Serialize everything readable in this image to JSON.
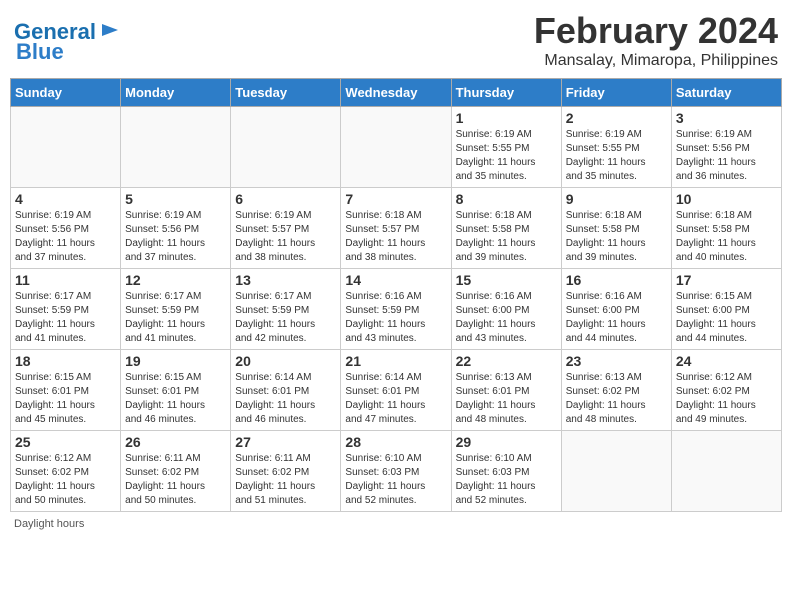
{
  "logo": {
    "line1": "General",
    "line2": "Blue"
  },
  "header": {
    "month": "February 2024",
    "location": "Mansalay, Mimaropa, Philippines"
  },
  "weekdays": [
    "Sunday",
    "Monday",
    "Tuesday",
    "Wednesday",
    "Thursday",
    "Friday",
    "Saturday"
  ],
  "weeks": [
    [
      {
        "day": "",
        "info": ""
      },
      {
        "day": "",
        "info": ""
      },
      {
        "day": "",
        "info": ""
      },
      {
        "day": "",
        "info": ""
      },
      {
        "day": "1",
        "info": "Sunrise: 6:19 AM\nSunset: 5:55 PM\nDaylight: 11 hours\nand 35 minutes."
      },
      {
        "day": "2",
        "info": "Sunrise: 6:19 AM\nSunset: 5:55 PM\nDaylight: 11 hours\nand 35 minutes."
      },
      {
        "day": "3",
        "info": "Sunrise: 6:19 AM\nSunset: 5:56 PM\nDaylight: 11 hours\nand 36 minutes."
      }
    ],
    [
      {
        "day": "4",
        "info": "Sunrise: 6:19 AM\nSunset: 5:56 PM\nDaylight: 11 hours\nand 37 minutes."
      },
      {
        "day": "5",
        "info": "Sunrise: 6:19 AM\nSunset: 5:56 PM\nDaylight: 11 hours\nand 37 minutes."
      },
      {
        "day": "6",
        "info": "Sunrise: 6:19 AM\nSunset: 5:57 PM\nDaylight: 11 hours\nand 38 minutes."
      },
      {
        "day": "7",
        "info": "Sunrise: 6:18 AM\nSunset: 5:57 PM\nDaylight: 11 hours\nand 38 minutes."
      },
      {
        "day": "8",
        "info": "Sunrise: 6:18 AM\nSunset: 5:58 PM\nDaylight: 11 hours\nand 39 minutes."
      },
      {
        "day": "9",
        "info": "Sunrise: 6:18 AM\nSunset: 5:58 PM\nDaylight: 11 hours\nand 39 minutes."
      },
      {
        "day": "10",
        "info": "Sunrise: 6:18 AM\nSunset: 5:58 PM\nDaylight: 11 hours\nand 40 minutes."
      }
    ],
    [
      {
        "day": "11",
        "info": "Sunrise: 6:17 AM\nSunset: 5:59 PM\nDaylight: 11 hours\nand 41 minutes."
      },
      {
        "day": "12",
        "info": "Sunrise: 6:17 AM\nSunset: 5:59 PM\nDaylight: 11 hours\nand 41 minutes."
      },
      {
        "day": "13",
        "info": "Sunrise: 6:17 AM\nSunset: 5:59 PM\nDaylight: 11 hours\nand 42 minutes."
      },
      {
        "day": "14",
        "info": "Sunrise: 6:16 AM\nSunset: 5:59 PM\nDaylight: 11 hours\nand 43 minutes."
      },
      {
        "day": "15",
        "info": "Sunrise: 6:16 AM\nSunset: 6:00 PM\nDaylight: 11 hours\nand 43 minutes."
      },
      {
        "day": "16",
        "info": "Sunrise: 6:16 AM\nSunset: 6:00 PM\nDaylight: 11 hours\nand 44 minutes."
      },
      {
        "day": "17",
        "info": "Sunrise: 6:15 AM\nSunset: 6:00 PM\nDaylight: 11 hours\nand 44 minutes."
      }
    ],
    [
      {
        "day": "18",
        "info": "Sunrise: 6:15 AM\nSunset: 6:01 PM\nDaylight: 11 hours\nand 45 minutes."
      },
      {
        "day": "19",
        "info": "Sunrise: 6:15 AM\nSunset: 6:01 PM\nDaylight: 11 hours\nand 46 minutes."
      },
      {
        "day": "20",
        "info": "Sunrise: 6:14 AM\nSunset: 6:01 PM\nDaylight: 11 hours\nand 46 minutes."
      },
      {
        "day": "21",
        "info": "Sunrise: 6:14 AM\nSunset: 6:01 PM\nDaylight: 11 hours\nand 47 minutes."
      },
      {
        "day": "22",
        "info": "Sunrise: 6:13 AM\nSunset: 6:01 PM\nDaylight: 11 hours\nand 48 minutes."
      },
      {
        "day": "23",
        "info": "Sunrise: 6:13 AM\nSunset: 6:02 PM\nDaylight: 11 hours\nand 48 minutes."
      },
      {
        "day": "24",
        "info": "Sunrise: 6:12 AM\nSunset: 6:02 PM\nDaylight: 11 hours\nand 49 minutes."
      }
    ],
    [
      {
        "day": "25",
        "info": "Sunrise: 6:12 AM\nSunset: 6:02 PM\nDaylight: 11 hours\nand 50 minutes."
      },
      {
        "day": "26",
        "info": "Sunrise: 6:11 AM\nSunset: 6:02 PM\nDaylight: 11 hours\nand 50 minutes."
      },
      {
        "day": "27",
        "info": "Sunrise: 6:11 AM\nSunset: 6:02 PM\nDaylight: 11 hours\nand 51 minutes."
      },
      {
        "day": "28",
        "info": "Sunrise: 6:10 AM\nSunset: 6:03 PM\nDaylight: 11 hours\nand 52 minutes."
      },
      {
        "day": "29",
        "info": "Sunrise: 6:10 AM\nSunset: 6:03 PM\nDaylight: 11 hours\nand 52 minutes."
      },
      {
        "day": "",
        "info": ""
      },
      {
        "day": "",
        "info": ""
      }
    ]
  ],
  "footer": "Daylight hours"
}
